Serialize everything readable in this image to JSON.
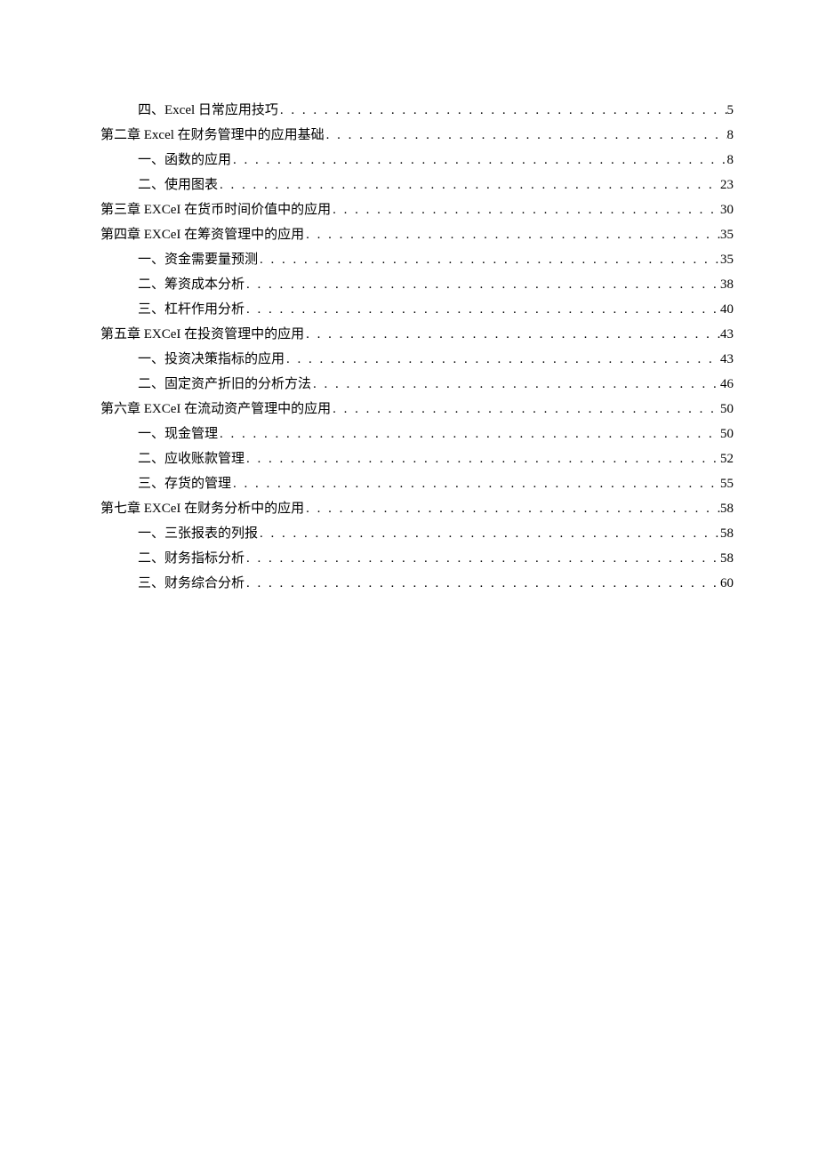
{
  "toc": [
    {
      "level": 2,
      "title": "四、Excel 日常应用技巧",
      "page": "5"
    },
    {
      "level": 1,
      "title": "第二章 Excel 在财务管理中的应用基础",
      "page": "8"
    },
    {
      "level": 2,
      "title": "一、函数的应用",
      "page": "8"
    },
    {
      "level": 2,
      "title": "二、使用图表",
      "page": "23"
    },
    {
      "level": 1,
      "title": "第三章 EXCeI 在货币时间价值中的应用",
      "page": "30"
    },
    {
      "level": 1,
      "title": "第四章 EXCeI 在筹资管理中的应用",
      "page": "35"
    },
    {
      "level": 2,
      "title": "一、资金需要量预测",
      "page": "35"
    },
    {
      "level": 2,
      "title": "二、筹资成本分析",
      "page": "38"
    },
    {
      "level": 2,
      "title": "三、杠杆作用分析",
      "page": "40"
    },
    {
      "level": 1,
      "title": "第五章 EXCeI 在投资管理中的应用",
      "page": "43"
    },
    {
      "level": 2,
      "title": "一、投资决策指标的应用",
      "page": "43"
    },
    {
      "level": 2,
      "title": "二、固定资产折旧的分析方法",
      "page": "46"
    },
    {
      "level": 1,
      "title": "第六章 EXCeI 在流动资产管理中的应用",
      "page": "50"
    },
    {
      "level": 2,
      "title": "一、现金管理",
      "page": "50"
    },
    {
      "level": 2,
      "title": "二、应收账款管理",
      "page": "52"
    },
    {
      "level": 2,
      "title": "三、存货的管理",
      "page": "55"
    },
    {
      "level": 1,
      "title": "第七章 EXCeI 在财务分析中的应用",
      "page": "58"
    },
    {
      "level": 2,
      "title": "一、三张报表的列报",
      "page": "58"
    },
    {
      "level": 2,
      "title": "二、财务指标分析",
      "page": "58"
    },
    {
      "level": 2,
      "title": "三、财务综合分析",
      "page": "60"
    }
  ]
}
